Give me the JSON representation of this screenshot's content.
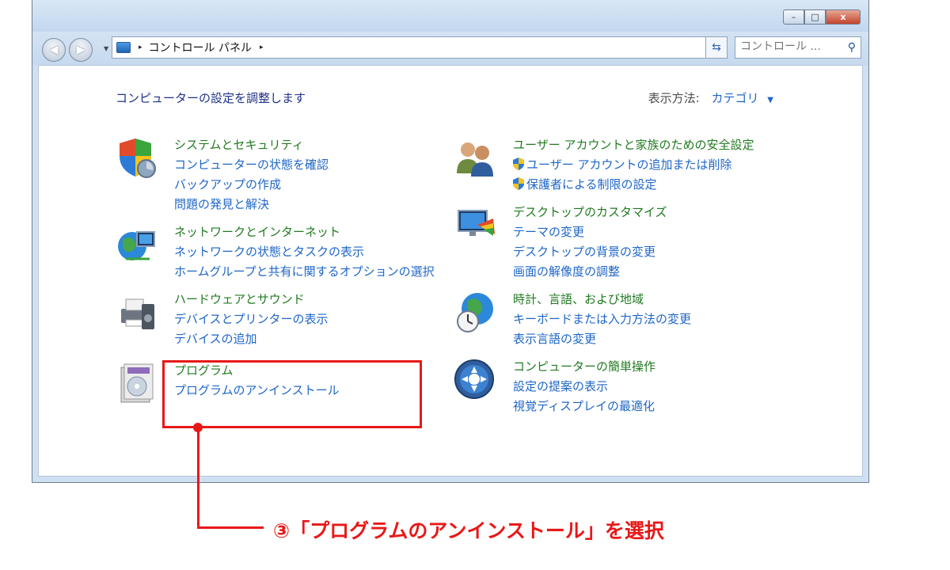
{
  "window": {
    "controls": {
      "minimize": "–",
      "maximize": "□",
      "close": "x"
    }
  },
  "address": {
    "breadcrumb": "コントロール パネル",
    "separator": "▸",
    "dropdown": "▾",
    "refresh": "⇆"
  },
  "search": {
    "placeholder": "コントロール ..."
  },
  "page": {
    "heading": "コンピューターの設定を調整します",
    "view_by_label": "表示方法:",
    "view_by_value": "カテゴリ",
    "view_by_arrow": "▼"
  },
  "categories": [
    {
      "title": "システムとセキュリティ",
      "links": [
        "コンピューターの状態を確認",
        "バックアップの作成",
        "問題の発見と解決"
      ]
    },
    {
      "title": "ネットワークとインターネット",
      "links": [
        "ネットワークの状態とタスクの表示",
        "ホームグループと共有に関するオプションの選択"
      ]
    },
    {
      "title": "ハードウェアとサウンド",
      "links": [
        "デバイスとプリンターの表示",
        "デバイスの追加"
      ]
    },
    {
      "title": "プログラム",
      "links": [
        "プログラムのアンインストール"
      ]
    },
    {
      "title": "ユーザー アカウントと家族のための安全設定",
      "links": [
        "ユーザー アカウントの追加または削除",
        "保護者による制限の設定"
      ]
    },
    {
      "title": "デスクトップのカスタマイズ",
      "links": [
        "テーマの変更",
        "デスクトップの背景の変更",
        "画面の解像度の調整"
      ]
    },
    {
      "title": "時計、言語、および地域",
      "links": [
        "キーボードまたは入力方法の変更",
        "表示言語の変更"
      ]
    },
    {
      "title": "コンピューターの簡単操作",
      "links": [
        "設定の提案の表示",
        "視覚ディスプレイの最適化"
      ]
    }
  ],
  "annotation": {
    "text": "③「プログラムのアンインストール」を選択",
    "color": "#e81818"
  },
  "colors": {
    "link": "#1e66c7",
    "category_title": "#217a21",
    "heading": "#1e3287"
  }
}
